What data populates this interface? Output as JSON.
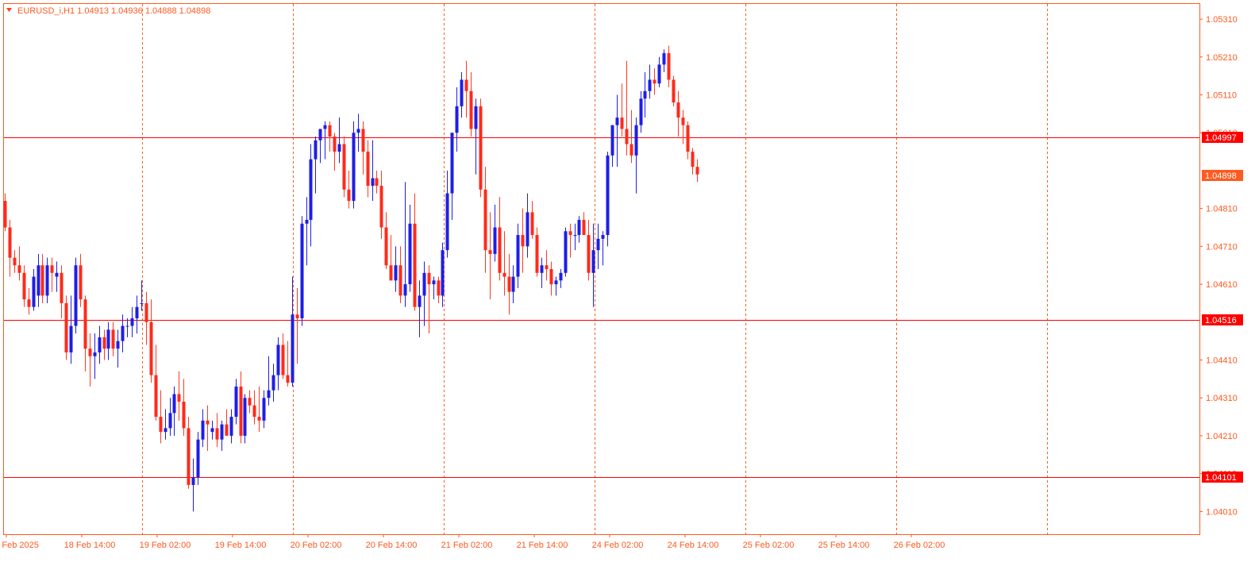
{
  "chart_data": {
    "type": "candlestick",
    "title": "EURUSD_i,H1  1.04913 1.04936 1.04888 1.04898",
    "symbol": "EURUSD_i",
    "timeframe": "H1",
    "last_bar": {
      "open": 1.04913,
      "high": 1.04936,
      "low": 1.04888,
      "close": 1.04898
    },
    "ylim": [
      1.0395,
      1.0535
    ],
    "y_ticks": [
      "1.05310",
      "1.05210",
      "1.05110",
      "1.05010",
      "1.04810",
      "1.04710",
      "1.04610",
      "1.04410",
      "1.04310",
      "1.04210",
      "1.04110",
      "1.04010"
    ],
    "x_ticks": [
      "18 Feb 2025",
      "18 Feb 14:00",
      "19 Feb 02:00",
      "19 Feb 14:00",
      "20 Feb 02:00",
      "20 Feb 14:00",
      "21 Feb 02:00",
      "21 Feb 14:00",
      "24 Feb 02:00",
      "24 Feb 14:00",
      "25 Feb 02:00",
      "25 Feb 14:00",
      "26 Feb 02:00"
    ],
    "vertical_grid_count": 7,
    "horizontal_levels": [
      {
        "price": 1.04997,
        "label": "1.04997"
      },
      {
        "price": 1.04516,
        "label": "1.04516"
      },
      {
        "price": 1.04101,
        "label": "1.04101"
      }
    ],
    "current_price": {
      "price": 1.04898,
      "label": "1.04898"
    },
    "colors": {
      "bull": "#1e1ee6",
      "bear": "#ff2a1a",
      "grid": "#ff5a1f",
      "level": "#ff0000",
      "tag_level": "#ff0000",
      "tag_price": "#ff5a1f",
      "text": "#ff5a1f"
    },
    "candles": [
      [
        1.0483,
        1.0485,
        1.0475,
        1.0476
      ],
      [
        1.0476,
        1.0478,
        1.0463,
        1.0468
      ],
      [
        1.0468,
        1.047,
        1.0464,
        1.0466
      ],
      [
        1.0466,
        1.0471,
        1.0462,
        1.0464
      ],
      [
        1.0464,
        1.0466,
        1.0455,
        1.0457
      ],
      [
        1.0457,
        1.046,
        1.0453,
        1.0455
      ],
      [
        1.0455,
        1.0465,
        1.0454,
        1.0463
      ],
      [
        1.0458,
        1.0469,
        1.0455,
        1.0466
      ],
      [
        1.0466,
        1.0469,
        1.0456,
        1.0458
      ],
      [
        1.0458,
        1.0468,
        1.0456,
        1.0466
      ],
      [
        1.0466,
        1.0468,
        1.0459,
        1.0464
      ],
      [
        1.0463,
        1.0467,
        1.0459,
        1.0464
      ],
      [
        1.0464,
        1.0466,
        1.0452,
        1.0456
      ],
      [
        1.0456,
        1.0458,
        1.0441,
        1.0443
      ],
      [
        1.0443,
        1.0458,
        1.044,
        1.045
      ],
      [
        1.045,
        1.0468,
        1.0448,
        1.0466
      ],
      [
        1.0466,
        1.0469,
        1.0455,
        1.0457
      ],
      [
        1.0457,
        1.0458,
        1.0438,
        1.0444
      ],
      [
        1.0444,
        1.0448,
        1.0434,
        1.0442
      ],
      [
        1.0442,
        1.0448,
        1.0436,
        1.0443
      ],
      [
        1.0443,
        1.045,
        1.044,
        1.0447
      ],
      [
        1.0447,
        1.0449,
        1.0441,
        1.0444
      ],
      [
        1.0444,
        1.0451,
        1.0441,
        1.0449
      ],
      [
        1.0449,
        1.0451,
        1.0442,
        1.0444
      ],
      [
        1.0444,
        1.0449,
        1.0439,
        1.0446
      ],
      [
        1.0446,
        1.0453,
        1.0443,
        1.045
      ],
      [
        1.045,
        1.0452,
        1.0447,
        1.045
      ],
      [
        1.045,
        1.0455,
        1.0447,
        1.0452
      ],
      [
        1.0452,
        1.0458,
        1.0448,
        1.0455
      ],
      [
        1.0456,
        1.0462,
        1.0454,
        1.0456
      ],
      [
        1.0456,
        1.0459,
        1.0445,
        1.0451
      ],
      [
        1.0451,
        1.0457,
        1.0435,
        1.0437
      ],
      [
        1.0437,
        1.0445,
        1.0425,
        1.0426
      ],
      [
        1.0426,
        1.0433,
        1.0419,
        1.0422
      ],
      [
        1.0422,
        1.0428,
        1.042,
        1.0423
      ],
      [
        1.0423,
        1.0431,
        1.0421,
        1.0427
      ],
      [
        1.0427,
        1.0434,
        1.0421,
        1.0432
      ],
      [
        1.0432,
        1.0438,
        1.0425,
        1.043
      ],
      [
        1.043,
        1.0436,
        1.0421,
        1.0423
      ],
      [
        1.0423,
        1.0426,
        1.0407,
        1.0408
      ],
      [
        1.0408,
        1.0415,
        1.0401,
        1.041
      ],
      [
        1.041,
        1.0422,
        1.0408,
        1.042
      ],
      [
        1.042,
        1.0428,
        1.0418,
        1.0425
      ],
      [
        1.0425,
        1.0429,
        1.0417,
        1.0424
      ],
      [
        1.0422,
        1.0425,
        1.042,
        1.0423
      ],
      [
        1.0423,
        1.0427,
        1.0418,
        1.042
      ],
      [
        1.042,
        1.0425,
        1.0417,
        1.0424
      ],
      [
        1.0424,
        1.0428,
        1.0421,
        1.0421
      ],
      [
        1.0421,
        1.0428,
        1.0419,
        1.0426
      ],
      [
        1.0426,
        1.0436,
        1.0424,
        1.0434
      ],
      [
        1.0434,
        1.0438,
        1.0419,
        1.0421
      ],
      [
        1.0421,
        1.0432,
        1.0419,
        1.0431
      ],
      [
        1.0431,
        1.0433,
        1.0427,
        1.0429
      ],
      [
        1.0429,
        1.0433,
        1.0424,
        1.0426
      ],
      [
        1.0426,
        1.0434,
        1.0422,
        1.0425
      ],
      [
        1.0425,
        1.0433,
        1.0423,
        1.0431
      ],
      [
        1.0431,
        1.0442,
        1.0429,
        1.0433
      ],
      [
        1.0433,
        1.044,
        1.043,
        1.0437
      ],
      [
        1.0437,
        1.0447,
        1.0433,
        1.0445
      ],
      [
        1.0445,
        1.0448,
        1.0436,
        1.0437
      ],
      [
        1.0437,
        1.0446,
        1.0434,
        1.0435
      ],
      [
        1.0435,
        1.0463,
        1.0434,
        1.0453
      ],
      [
        1.0453,
        1.046,
        1.044,
        1.0452
      ],
      [
        1.0452,
        1.0479,
        1.045,
        1.0477
      ],
      [
        1.0477,
        1.0484,
        1.0466,
        1.0478
      ],
      [
        1.0478,
        1.0498,
        1.0471,
        1.0494
      ],
      [
        1.0494,
        1.05,
        1.0485,
        1.0499
      ],
      [
        1.0499,
        1.0502,
        1.0493,
        1.0502
      ],
      [
        1.0502,
        1.0504,
        1.0494,
        1.0503
      ],
      [
        1.0503,
        1.0504,
        1.0496,
        1.05
      ],
      [
        1.05,
        1.0501,
        1.0491,
        1.0496
      ],
      [
        1.0496,
        1.0505,
        1.0493,
        1.0498
      ],
      [
        1.0498,
        1.05,
        1.0484,
        1.0486
      ],
      [
        1.0486,
        1.0491,
        1.0481,
        1.0483
      ],
      [
        1.0483,
        1.0504,
        1.0481,
        1.0501
      ],
      [
        1.0501,
        1.0506,
        1.0496,
        1.0502
      ],
      [
        1.0502,
        1.0504,
        1.049,
        1.0496
      ],
      [
        1.0496,
        1.0499,
        1.0484,
        1.0487
      ],
      [
        1.0487,
        1.0499,
        1.0483,
        1.0489
      ],
      [
        1.0489,
        1.0491,
        1.0485,
        1.0487
      ],
      [
        1.0487,
        1.0491,
        1.0473,
        1.0476
      ],
      [
        1.0476,
        1.048,
        1.0465,
        1.0466
      ],
      [
        1.0466,
        1.0474,
        1.0462,
        1.0462
      ],
      [
        1.0462,
        1.0471,
        1.0459,
        1.0466
      ],
      [
        1.0466,
        1.0471,
        1.0456,
        1.0458
      ],
      [
        1.0458,
        1.0488,
        1.0455,
        1.0461
      ],
      [
        1.0461,
        1.0482,
        1.0459,
        1.0477
      ],
      [
        1.0477,
        1.0485,
        1.0454,
        1.0455
      ],
      [
        1.0455,
        1.0462,
        1.0447,
        1.0458
      ],
      [
        1.0458,
        1.0467,
        1.045,
        1.0464
      ],
      [
        1.0464,
        1.0466,
        1.0448,
        1.0461
      ],
      [
        1.0461,
        1.0463,
        1.0457,
        1.0462
      ],
      [
        1.0462,
        1.0463,
        1.0456,
        1.0458
      ],
      [
        1.0458,
        1.0472,
        1.0455,
        1.047
      ],
      [
        1.047,
        1.0491,
        1.0468,
        1.0485
      ],
      [
        1.0485,
        1.0501,
        1.0478,
        1.0501
      ],
      [
        1.0501,
        1.0513,
        1.0496,
        1.0508
      ],
      [
        1.0508,
        1.0517,
        1.0505,
        1.0515
      ],
      [
        1.0515,
        1.052,
        1.0505,
        1.0512
      ],
      [
        1.0512,
        1.0517,
        1.05,
        1.0502
      ],
      [
        1.0502,
        1.051,
        1.049,
        1.0508
      ],
      [
        1.0508,
        1.051,
        1.0484,
        1.0486
      ],
      [
        1.0486,
        1.0492,
        1.0464,
        1.047
      ],
      [
        1.047,
        1.048,
        1.0457,
        1.0469
      ],
      [
        1.0469,
        1.0482,
        1.0467,
        1.0476
      ],
      [
        1.0476,
        1.0484,
        1.0462,
        1.0464
      ],
      [
        1.0464,
        1.0475,
        1.0458,
        1.0463
      ],
      [
        1.0463,
        1.0469,
        1.0453,
        1.0459
      ],
      [
        1.0459,
        1.0466,
        1.0456,
        1.0463
      ],
      [
        1.0463,
        1.0477,
        1.046,
        1.0474
      ],
      [
        1.0474,
        1.0481,
        1.0464,
        1.0471
      ],
      [
        1.0471,
        1.0485,
        1.0468,
        1.048
      ],
      [
        1.048,
        1.0483,
        1.0473,
        1.0474
      ],
      [
        1.0474,
        1.0476,
        1.0463,
        1.0464
      ],
      [
        1.0464,
        1.0468,
        1.046,
        1.0466
      ],
      [
        1.0466,
        1.047,
        1.0462,
        1.0465
      ],
      [
        1.0465,
        1.0467,
        1.0458,
        1.0461
      ],
      [
        1.0461,
        1.0463,
        1.0458,
        1.0462
      ],
      [
        1.0462,
        1.0465,
        1.046,
        1.0464
      ],
      [
        1.0464,
        1.0476,
        1.0463,
        1.0475
      ],
      [
        1.0475,
        1.0477,
        1.0468,
        1.0474
      ],
      [
        1.0474,
        1.0477,
        1.047,
        1.0474
      ],
      [
        1.0474,
        1.0479,
        1.0472,
        1.0478
      ],
      [
        1.0478,
        1.048,
        1.0474,
        1.0474
      ],
      [
        1.0474,
        1.0478,
        1.0462,
        1.0464
      ],
      [
        1.0464,
        1.0477,
        1.0455,
        1.047
      ],
      [
        1.047,
        1.0477,
        1.0465,
        1.0473
      ],
      [
        1.0473,
        1.0475,
        1.0466,
        1.0474
      ],
      [
        1.0474,
        1.0496,
        1.0471,
        1.0495
      ],
      [
        1.0495,
        1.0503,
        1.0492,
        1.0503
      ],
      [
        1.0503,
        1.0511,
        1.0492,
        1.0505
      ],
      [
        1.0505,
        1.0514,
        1.05,
        1.0502
      ],
      [
        1.0502,
        1.052,
        1.0495,
        1.0498
      ],
      [
        1.0498,
        1.0507,
        1.0493,
        1.0495
      ],
      [
        1.0495,
        1.0505,
        1.0485,
        1.0503
      ],
      [
        1.0503,
        1.0512,
        1.0501,
        1.051
      ],
      [
        1.051,
        1.0517,
        1.0505,
        1.0512
      ],
      [
        1.0512,
        1.0519,
        1.051,
        1.0515
      ],
      [
        1.0515,
        1.0518,
        1.0511,
        1.0514
      ],
      [
        1.0514,
        1.0521,
        1.0513,
        1.0519
      ],
      [
        1.0519,
        1.0523,
        1.0517,
        1.0522
      ],
      [
        1.0522,
        1.0524,
        1.0513,
        1.0515
      ],
      [
        1.0515,
        1.0516,
        1.0508,
        1.0509
      ],
      [
        1.0509,
        1.0512,
        1.05,
        1.0505
      ],
      [
        1.0505,
        1.0507,
        1.0498,
        1.0503
      ],
      [
        1.0503,
        1.0504,
        1.0494,
        1.0496
      ],
      [
        1.0496,
        1.0497,
        1.049,
        1.0492
      ],
      [
        1.0492,
        1.0494,
        1.0488,
        1.049
      ]
    ]
  }
}
